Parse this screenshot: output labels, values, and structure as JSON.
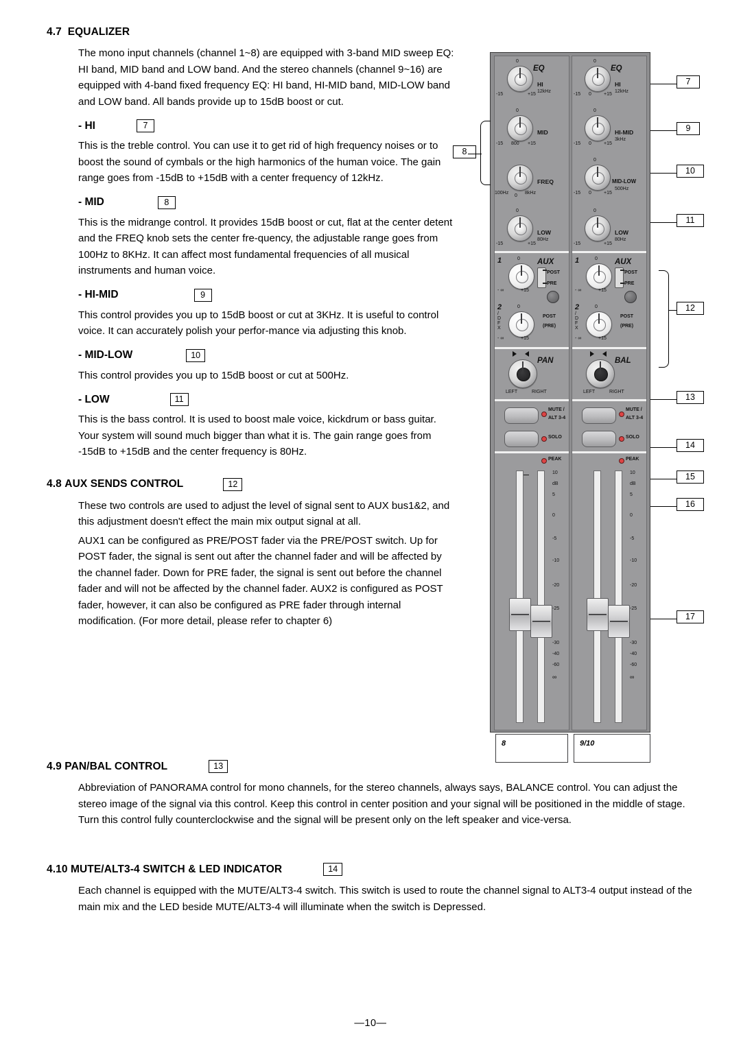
{
  "document": {
    "page_number": "—10—",
    "sections": [
      {
        "number": "4.7",
        "title": "EQUALIZER",
        "intro": "The mono input channels (channel 1~8) are equipped with 3-band MID sweep EQ: HI band, MID band and LOW band. And the stereo channels (channel 9~16) are equipped with 4-band fixed frequency EQ: HI band, HI-MID band, MID-LOW band and LOW band. All bands provide up to 15dB boost or cut."
      }
    ],
    "subsections": [
      {
        "label": "- HI",
        "callout": "7",
        "body": "This is the treble control. You can use it to get rid of high frequency noises or to boost the sound of cymbals or the high harmonics of the human voice. The gain range goes from -15dB to +15dB with a center frequency of 12kHz."
      },
      {
        "label": "- MID",
        "callout": "8",
        "body": "This is the midrange control. It provides 15dB boost or cut, flat at the center detent and the FREQ knob sets the center fre-quency, the adjustable range goes from 100Hz to 8KHz. It can affect most fundamental frequencies of all musical instruments and human voice."
      },
      {
        "label": "- HI-MID",
        "callout": "9",
        "body": "This control provides you up to 15dB boost or cut at 3KHz. It is useful to control voice. It can accurately polish your perfor-mance via adjusting this knob."
      },
      {
        "label": "- MID-LOW",
        "callout": "10",
        "body": "This control provides you up to 15dB boost or cut at 500Hz."
      },
      {
        "label": "- LOW",
        "callout": "11",
        "body": "This is the bass control. It is used to boost male voice, kickdrum or bass guitar. Your system will sound much bigger than what it is. The gain range goes from -15dB to +15dB and the center frequency is 80Hz."
      }
    ],
    "aux": {
      "number": "4.8",
      "title": "AUX SENDS CONTROL",
      "callout": "12",
      "p1": "These two controls are used to adjust the level of signal sent to AUX bus1&2, and this adjustment doesn't effect the main mix output signal at all.",
      "p2": "AUX1 can be configured as PRE/POST fader via the PRE/POST switch. Up for POST fader, the signal is sent out after the channel fader and will be affected by the channel fader. Down for PRE fader, the signal is sent out before the channel fader and will not be affected by the channel fader. AUX2 is configured as POST fader, however, it can also be configured as PRE fader through internal modification. (For more detail, please refer to chapter 6)"
    },
    "pan": {
      "number": "4.9",
      "title": "PAN/BAL CONTROL",
      "callout": "13",
      "body": "Abbreviation of PANORAMA control for mono channels, for the stereo channels, always says, BALANCE control. You can adjust the stereo image of the signal via this control. Keep this control in center position and your signal will be positioned in the middle of stage. Turn this control fully counterclockwise and the signal will be present only on the left speaker and vice-versa."
    },
    "mute": {
      "number": "4.10",
      "title": "MUTE/ALT3-4 SWITCH & LED INDICATOR",
      "callout": "14",
      "body": "Each channel is equipped with the MUTE/ALT3-4 switch. This switch is used to route the channel signal to ALT3-4 output instead of the main mix and the LED beside MUTE/ALT3-4 will illuminate when the switch is Depressed."
    }
  },
  "figure": {
    "callouts": {
      "c7": "7",
      "c8": "8",
      "c9": "9",
      "c10": "10",
      "c11": "11",
      "c12": "12",
      "c13": "13",
      "c14": "14",
      "c15": "15",
      "c16": "16",
      "c17": "17"
    },
    "mono_strip": {
      "channel_label": "8",
      "eq_title": "EQ",
      "knobs": [
        {
          "name": "HI",
          "freq": "12kHz",
          "left": "-15",
          "center": "0",
          "right": "+15"
        },
        {
          "name": "MID",
          "freq": "",
          "left": "-15",
          "center": "800",
          "right": "+15"
        },
        {
          "name": "FREQ",
          "freq": "",
          "left": "100Hz",
          "center": "0",
          "right": "8kHz"
        },
        {
          "name": "LOW",
          "freq": "80Hz",
          "left": "-15",
          "center": "0",
          "right": "+15"
        }
      ],
      "aux_title": "AUX",
      "aux1_num": "1",
      "aux2_num": "2",
      "aux2_sub": "/ DFX",
      "aux_min": "- ∞",
      "aux_max": "+15",
      "post": "POST",
      "pre": "PRE",
      "post2": "POST",
      "pre2": "(PRE)",
      "pan_title": "PAN",
      "pan_left": "LEFT",
      "pan_right": "RIGHT",
      "mute_label": "MUTE /",
      "alt_label": "ALT 3-4",
      "solo_label": "SOLO",
      "peak_label": "PEAK",
      "meter_scale": [
        "10",
        "dB",
        "5",
        "0",
        "-5",
        "-10",
        "-20",
        "-25",
        "-30",
        "-40",
        "-60",
        "∞"
      ]
    },
    "stereo_strip": {
      "channel_label": "9/10",
      "eq_title": "EQ",
      "knobs": [
        {
          "name": "HI",
          "freq": "12kHz",
          "left": "-15",
          "center": "0",
          "right": "+15"
        },
        {
          "name": "HI-MID",
          "freq": "3kHz",
          "left": "-15",
          "center": "0",
          "right": "+15"
        },
        {
          "name": "MID-LOW",
          "freq": "500Hz",
          "left": "-15",
          "center": "0",
          "right": "+15"
        },
        {
          "name": "LOW",
          "freq": "80Hz",
          "left": "-15",
          "center": "0",
          "right": "+15"
        }
      ],
      "aux_title": "AUX",
      "aux1_num": "1",
      "aux2_num": "2",
      "aux2_sub": "/ DFX",
      "aux_min": "- ∞",
      "aux_max": "+15",
      "post": "POST",
      "pre": "PRE",
      "post2": "POST",
      "pre2": "(PRE)",
      "bal_title": "BAL",
      "bal_left": "LEFT",
      "bal_right": "RIGHT",
      "mute_label": "MUTE /",
      "alt_label": "ALT 3-4",
      "solo_label": "SOLO",
      "peak_label": "PEAK",
      "meter_scale": [
        "10",
        "dB",
        "5",
        "0",
        "-5",
        "-10",
        "-20",
        "-25",
        "-30",
        "-40",
        "-60",
        "∞"
      ]
    }
  }
}
